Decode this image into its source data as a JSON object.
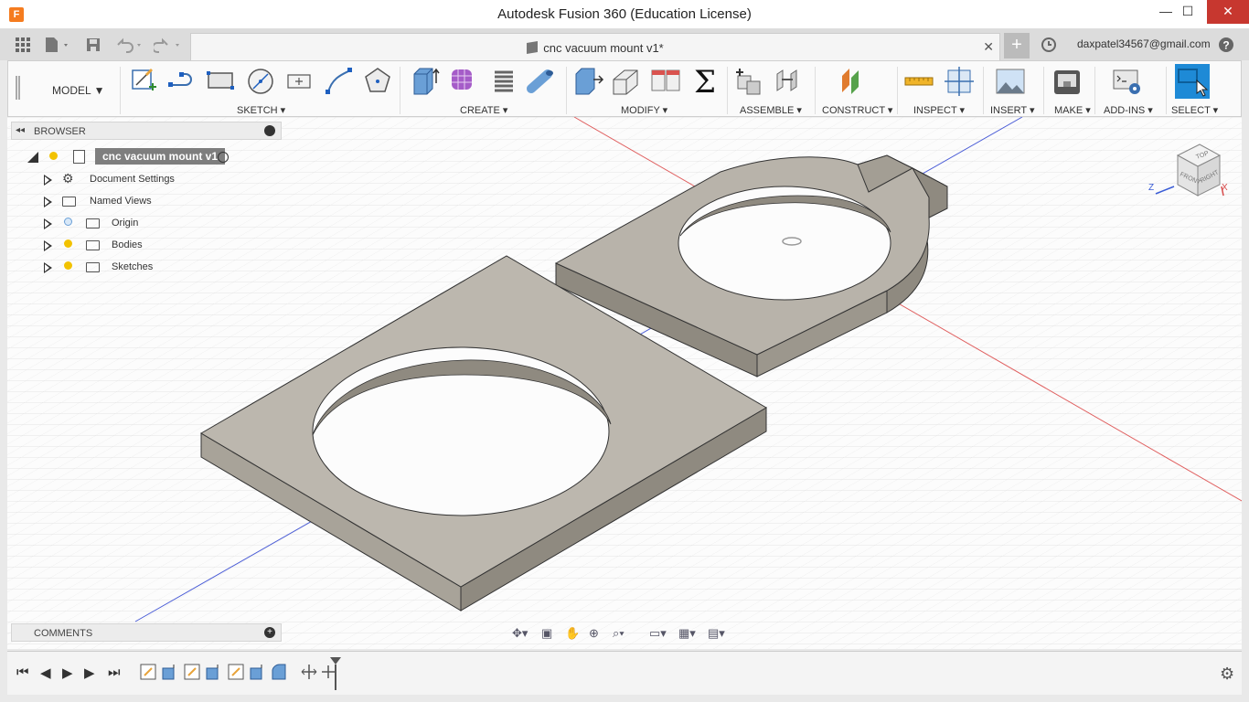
{
  "window": {
    "title": "Autodesk Fusion 360 (Education License)",
    "app_logo": "F",
    "minimize": "—",
    "maximize": "☐",
    "close": "✕"
  },
  "tabs": {
    "document_tab_label": "cnc vacuum mount v1*",
    "close_glyph": "✕",
    "new_tab_glyph": "+",
    "user_email": "daxpatel34567@gmail.com",
    "help_glyph": "?"
  },
  "ribbon": {
    "workspace_label": "MODEL ▼",
    "groups": [
      {
        "key": "sketch",
        "label": "SKETCH ▾"
      },
      {
        "key": "create",
        "label": "CREATE ▾"
      },
      {
        "key": "modify",
        "label": "MODIFY ▾"
      },
      {
        "key": "assemble",
        "label": "ASSEMBLE ▾"
      },
      {
        "key": "construct",
        "label": "CONSTRUCT ▾"
      },
      {
        "key": "inspect",
        "label": "INSPECT ▾"
      },
      {
        "key": "insert",
        "label": "INSERT ▾"
      },
      {
        "key": "make",
        "label": "MAKE ▾"
      },
      {
        "key": "addins",
        "label": "ADD-INS ▾"
      },
      {
        "key": "select",
        "label": "SELECT ▾"
      }
    ],
    "icons": [
      "create-sketch-icon",
      "line-icon",
      "rectangle-icon",
      "circle-icon",
      "point-icon",
      "spline-icon",
      "polygon-icon",
      "extrude-icon",
      "form-icon",
      "coil-icon",
      "pipe-icon",
      "press-pull-icon",
      "fillet-icon",
      "compute-all-icon",
      "parameters-icon",
      "new-component-icon",
      "joint-icon",
      "offset-plane-icon",
      "measure-icon",
      "section-analysis-icon",
      "insert-canvas-icon",
      "3d-print-icon",
      "scripts-icon",
      "select-icon"
    ]
  },
  "browser": {
    "title": "BROWSER",
    "root_label": "cnc vacuum mount v1",
    "items": [
      {
        "label": "Document Settings",
        "icon": "gear-icon"
      },
      {
        "label": "Named Views",
        "icon": "folder-icon"
      },
      {
        "label": "Origin",
        "icon": "folder-icon"
      },
      {
        "label": "Bodies",
        "icon": "folder-icon"
      },
      {
        "label": "Sketches",
        "icon": "folder-icon"
      }
    ]
  },
  "comments": {
    "title": "COMMENTS"
  },
  "viewcube": {
    "top": "TOP",
    "front": "FRONT",
    "right": "RIGHT",
    "axis_x": "X",
    "axis_z": "Z"
  },
  "colors": {
    "accent": "#1e8ad6",
    "close_red": "#c7372f",
    "model_face": "#b8b3aa",
    "model_side": "#8f8a80"
  }
}
